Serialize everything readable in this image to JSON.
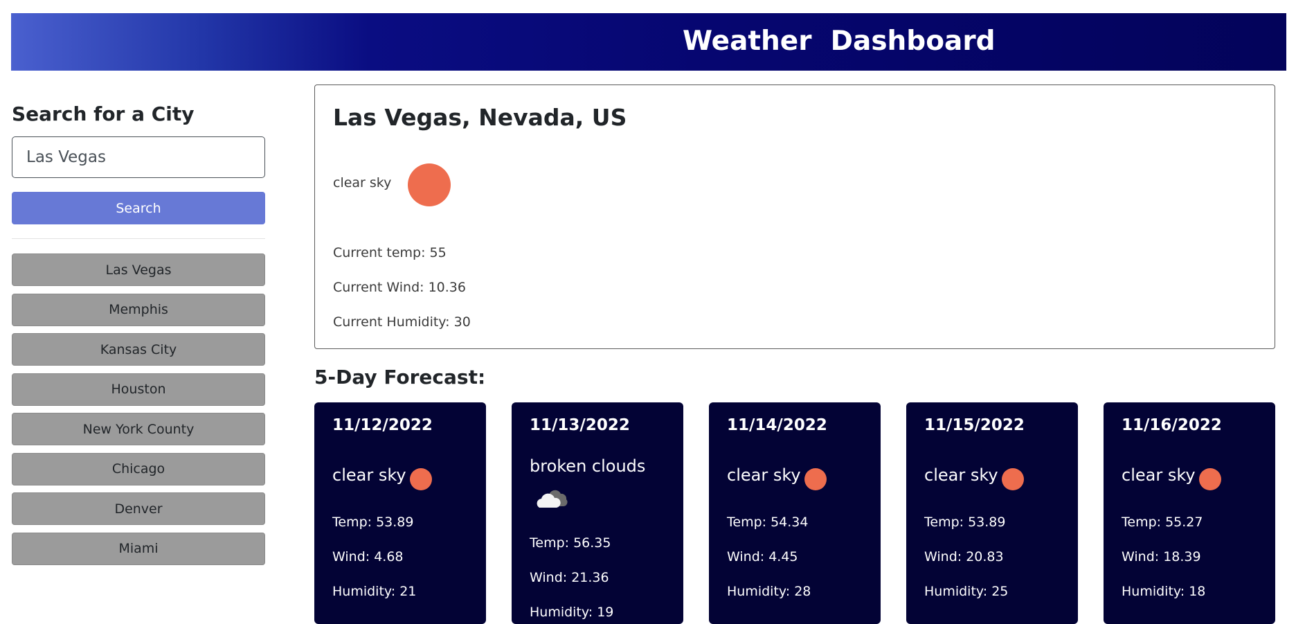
{
  "header": {
    "title": "Weather  Dashboard"
  },
  "sidebar": {
    "heading": "Search for a City",
    "search_value": "Las Vegas",
    "search_button": "Search",
    "history": [
      "Las Vegas",
      "Memphis",
      "Kansas City",
      "Houston",
      "New York County",
      "Chicago",
      "Denver",
      "Miami"
    ]
  },
  "current": {
    "city": "Las Vegas, Nevada, US",
    "description": "clear sky",
    "icon": "sun-icon",
    "temp": "Current temp: 55",
    "wind": "Current Wind: 10.36",
    "humidity": "Current Humidity: 30"
  },
  "forecast": {
    "title": "5-Day Forecast:",
    "days": [
      {
        "date": "11/12/2022",
        "description": "clear sky",
        "icon": "sun-icon",
        "temp": "Temp: 53.89",
        "wind": "Wind: 4.68",
        "humidity": "Humidity: 21"
      },
      {
        "date": "11/13/2022",
        "description": "broken clouds",
        "icon": "cloud-icon",
        "temp": "Temp: 56.35",
        "wind": "Wind: 21.36",
        "humidity": "Humidity: 19"
      },
      {
        "date": "11/14/2022",
        "description": "clear sky",
        "icon": "sun-icon",
        "temp": "Temp: 54.34",
        "wind": "Wind: 4.45",
        "humidity": "Humidity: 28"
      },
      {
        "date": "11/15/2022",
        "description": "clear sky",
        "icon": "sun-icon",
        "temp": "Temp: 53.89",
        "wind": "Wind: 20.83",
        "humidity": "Humidity: 25"
      },
      {
        "date": "11/16/2022",
        "description": "clear sky",
        "icon": "sun-icon",
        "temp": "Temp: 55.27",
        "wind": "Wind: 18.39",
        "humidity": "Humidity: 18"
      }
    ]
  },
  "colors": {
    "accent": "#6779d6",
    "card_bg": "#030335",
    "sun": "#ee6d4e",
    "history_btn": "#9b9b9b"
  }
}
